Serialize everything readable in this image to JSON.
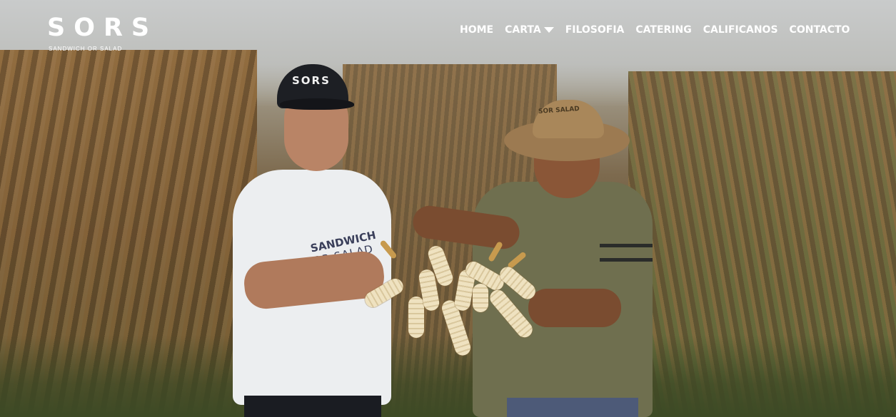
{
  "brand": {
    "name": "SORS",
    "tagline": "SANDWICH OR SALAD"
  },
  "nav": {
    "items": [
      {
        "label": "HOME"
      },
      {
        "label": "CARTA"
      },
      {
        "label": "FILOSOFIA"
      },
      {
        "label": "CATERING"
      },
      {
        "label": "CALIFICANOS"
      },
      {
        "label": "CONTACTO"
      }
    ],
    "dropdown_icon": "caret-down-icon"
  },
  "hero": {
    "cap_text": "SORS",
    "shirt_text_line1": "SANDWICH",
    "shirt_text_line2": "OR SALAD",
    "hat_text": "SOR SALAD"
  },
  "colors": {
    "nav_text": "#ffffff",
    "logo_text": "#ffffff"
  }
}
